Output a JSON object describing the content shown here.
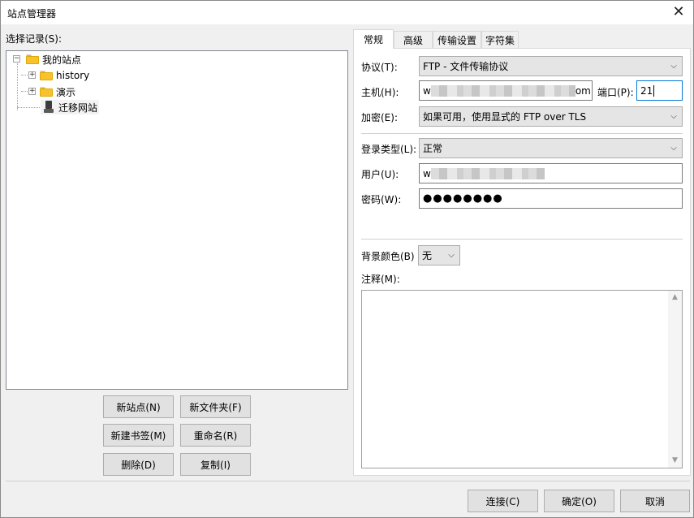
{
  "window": {
    "title": "站点管理器",
    "close_glyph": "✕"
  },
  "left": {
    "select_label": "选择记录(S):",
    "tree": {
      "root": "我的站点",
      "folders": [
        "history",
        "演示"
      ],
      "site": "迁移网站",
      "expand_glyph": "+",
      "collapse_glyph": "−"
    },
    "buttons": {
      "new_site": "新站点(N)",
      "new_folder": "新文件夹(F)",
      "new_bookmark": "新建书签(M)",
      "rename": "重命名(R)",
      "delete": "删除(D)",
      "copy": "复制(I)"
    }
  },
  "tabs": [
    "常规",
    "高级",
    "传输设置",
    "字符集"
  ],
  "general": {
    "protocol_label": "协议(T):",
    "protocol_value": "FTP - 文件传输协议",
    "host_label": "主机(H):",
    "host_value_prefix": "w",
    "host_value_suffix": "om",
    "port_label": "端口(P):",
    "port_value": "21",
    "encryption_label": "加密(E):",
    "encryption_value": "如果可用，使用显式的 FTP over TLS",
    "logon_type_label": "登录类型(L):",
    "logon_type_value": "正常",
    "user_label": "用户(U):",
    "user_value_prefix": "w",
    "password_label": "密码(W):",
    "password_value": "●●●●●●●●",
    "bg_color_label": "背景颜色(B)",
    "bg_color_value": "无",
    "comments_label": "注释(M):",
    "dropdown_glyph": "⌵",
    "scroll_up_glyph": "▲",
    "scroll_down_glyph": "▼"
  },
  "footer": {
    "connect": "连接(C)",
    "ok": "确定(O)",
    "cancel": "取消"
  },
  "colors": {
    "focus_border": "#0078d7",
    "folder": "#f8c22c",
    "button_face": "#e1e1e1"
  }
}
